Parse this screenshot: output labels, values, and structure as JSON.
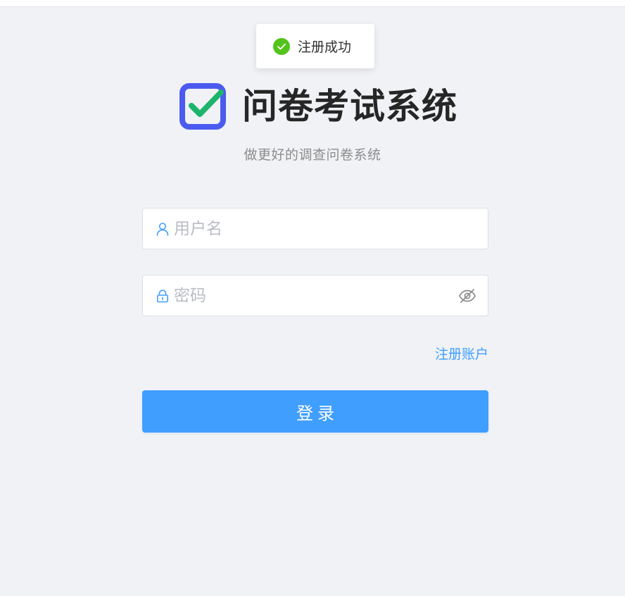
{
  "toast": {
    "message": "注册成功",
    "icon": "success-check-icon",
    "color": "#52c41a"
  },
  "brand": {
    "title": "问卷考试系统",
    "subtitle": "做更好的调查问卷系统",
    "logo_icon": "checkbox-logo-icon",
    "logo_color": "#4b5bf0",
    "check_color": "#1db46b"
  },
  "login_form": {
    "username": {
      "placeholder": "用户名",
      "value": "",
      "icon": "user-icon"
    },
    "password": {
      "placeholder": "密码",
      "value": "",
      "icon": "lock-icon",
      "toggle_icon": "eye-off-icon"
    },
    "register_link": "注册账户",
    "submit_label": "登录"
  },
  "colors": {
    "primary": "#409eff",
    "background": "#f0f2f5"
  }
}
